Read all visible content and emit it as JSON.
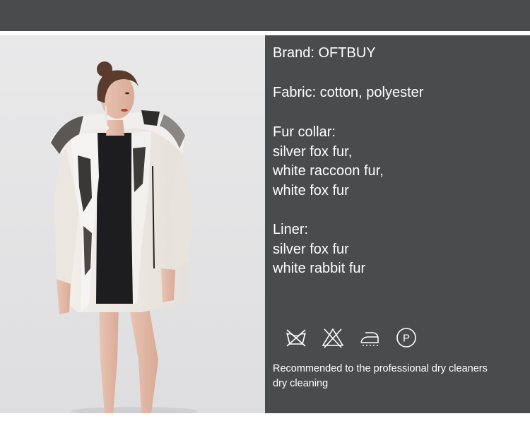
{
  "specs": {
    "brand": "Brand: OFTBUY",
    "fabric": "Fabric: cotton, polyester",
    "fur_collar": {
      "heading": "Fur collar:",
      "items": [
        "silver fox fur,",
        "white raccoon fur,",
        "white fox fur"
      ]
    },
    "liner": {
      "heading": "Liner:",
      "items": [
        "silver fox fur",
        "white rabbit fur"
      ]
    }
  },
  "care": {
    "icons": [
      "do-not-wash-icon",
      "do-not-bleach-icon",
      "iron-low-heat-icon",
      "professional-dry-clean-p-icon"
    ],
    "p_symbol": "P",
    "notes": [
      "Recommended to the professional dry cleaners",
      "dry cleaning"
    ]
  },
  "colors": {
    "panel": "#4a4b4d",
    "text": "#ffffff",
    "photo_background": "#e4e4e6"
  }
}
